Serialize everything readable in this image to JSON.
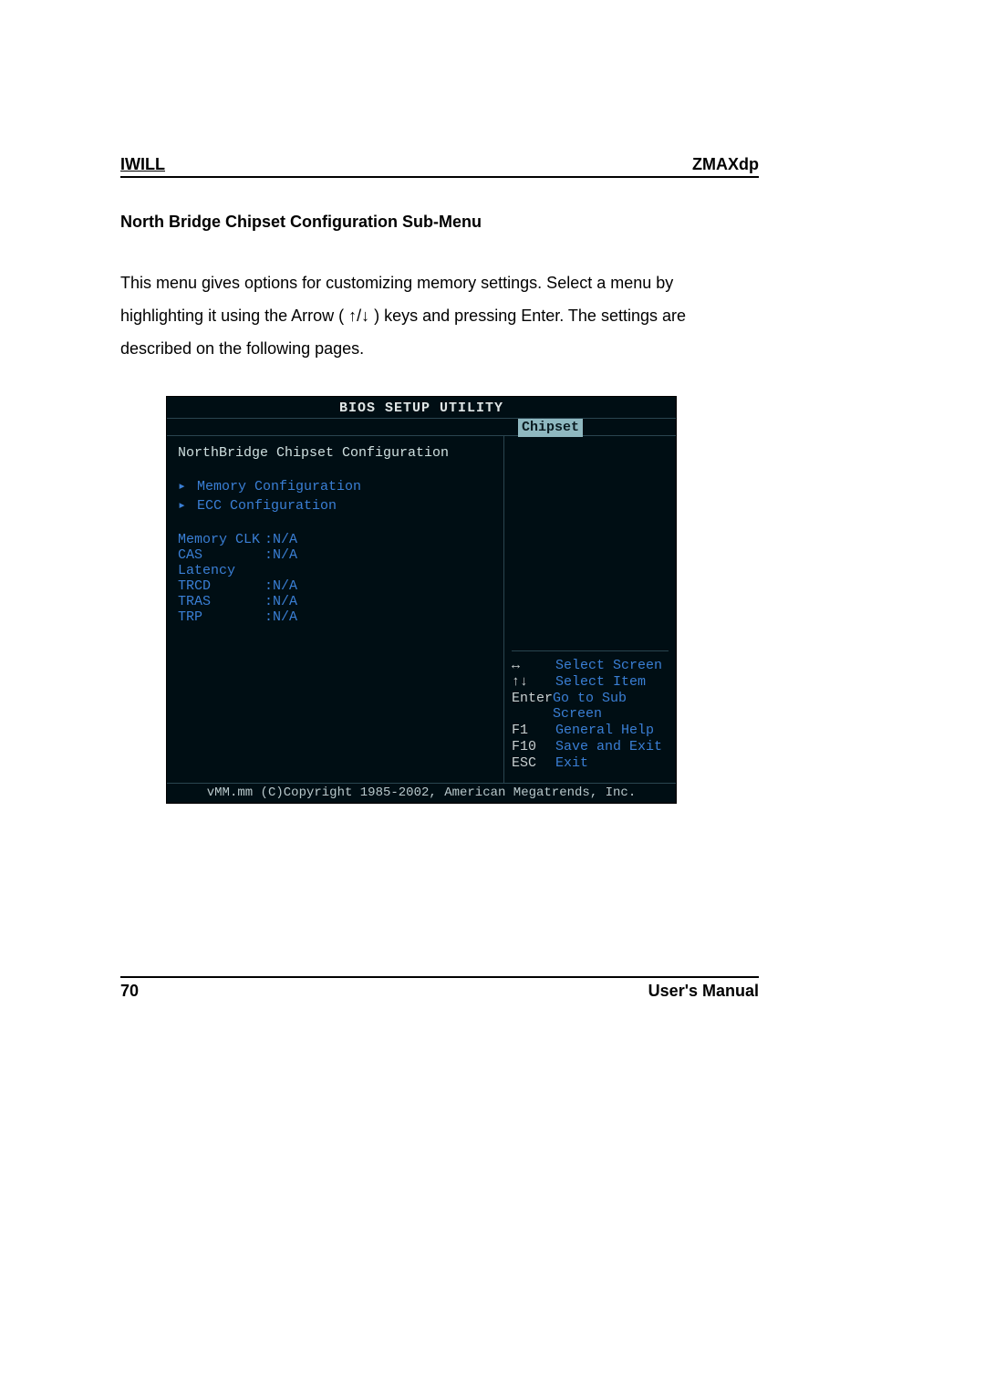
{
  "header": {
    "left": "IWILL",
    "right": "ZMAXdp"
  },
  "section_title": "North Bridge Chipset Configuration Sub-Menu",
  "body_text": "This menu gives options for customizing memory settings. Select a menu by highlighting it using the Arrow ( ↑/↓ ) keys and pressing Enter. The settings are described on the following pages.",
  "bios": {
    "title": "BIOS SETUP UTILITY",
    "active_tab": "Chipset",
    "panel_title": "NorthBridge Chipset Configuration",
    "submenus": [
      "Memory Configuration",
      "ECC Configuration"
    ],
    "params": [
      {
        "label": "Memory CLK",
        "value": ":N/A"
      },
      {
        "label": "CAS Latency",
        "value": ":N/A"
      },
      {
        "label": "TRCD",
        "value": ":N/A"
      },
      {
        "label": "TRAS",
        "value": ":N/A"
      },
      {
        "label": "TRP",
        "value": ":N/A"
      }
    ],
    "help": [
      {
        "key": "↔",
        "desc": "Select Screen"
      },
      {
        "key": "↑↓",
        "desc": "Select Item"
      },
      {
        "key": "Enter",
        "desc": "Go to Sub Screen"
      },
      {
        "key": "F1",
        "desc": "General Help"
      },
      {
        "key": "F10",
        "desc": "Save and Exit"
      },
      {
        "key": "ESC",
        "desc": "Exit"
      }
    ],
    "copyright": "vMM.mm (C)Copyright 1985-2002, American Megatrends, Inc."
  },
  "footer": {
    "page": "70",
    "label": "User's Manual"
  }
}
